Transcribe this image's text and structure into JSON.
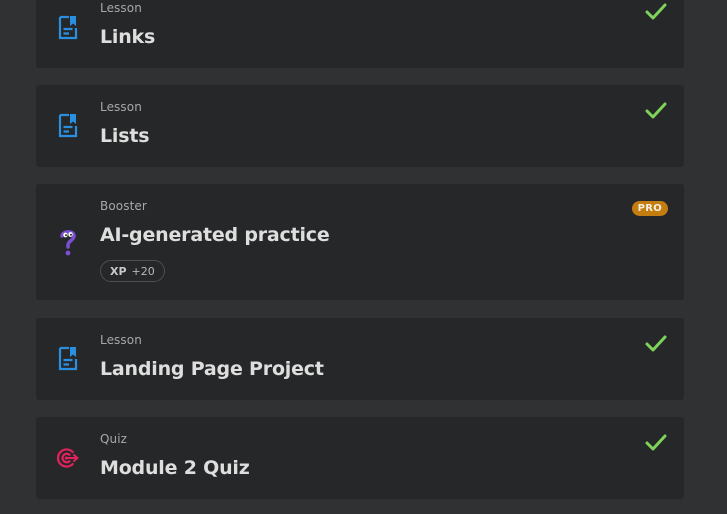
{
  "items": [
    {
      "type": "Lesson",
      "title": "Links",
      "icon": "lesson-document-icon",
      "completed": true
    },
    {
      "type": "Lesson",
      "title": "Lists",
      "icon": "lesson-document-icon",
      "completed": true
    },
    {
      "type": "Booster",
      "title": "AI-generated practice",
      "icon": "booster-question-icon",
      "completed": false,
      "badge": "PRO",
      "xp_label": "XP",
      "xp_value": "+20"
    },
    {
      "type": "Lesson",
      "title": "Landing Page Project",
      "icon": "lesson-document-icon",
      "completed": true
    },
    {
      "type": "Quiz",
      "title": "Module 2 Quiz",
      "icon": "quiz-target-icon",
      "completed": true
    }
  ],
  "colors": {
    "background": "#303132",
    "card": "#262728",
    "check": "#7fd35a",
    "lesson_icon": "#2a8fe0",
    "booster_icon": "#7b4fd6",
    "quiz_icon": "#e2215d",
    "pro_badge": "#c47d0f"
  }
}
